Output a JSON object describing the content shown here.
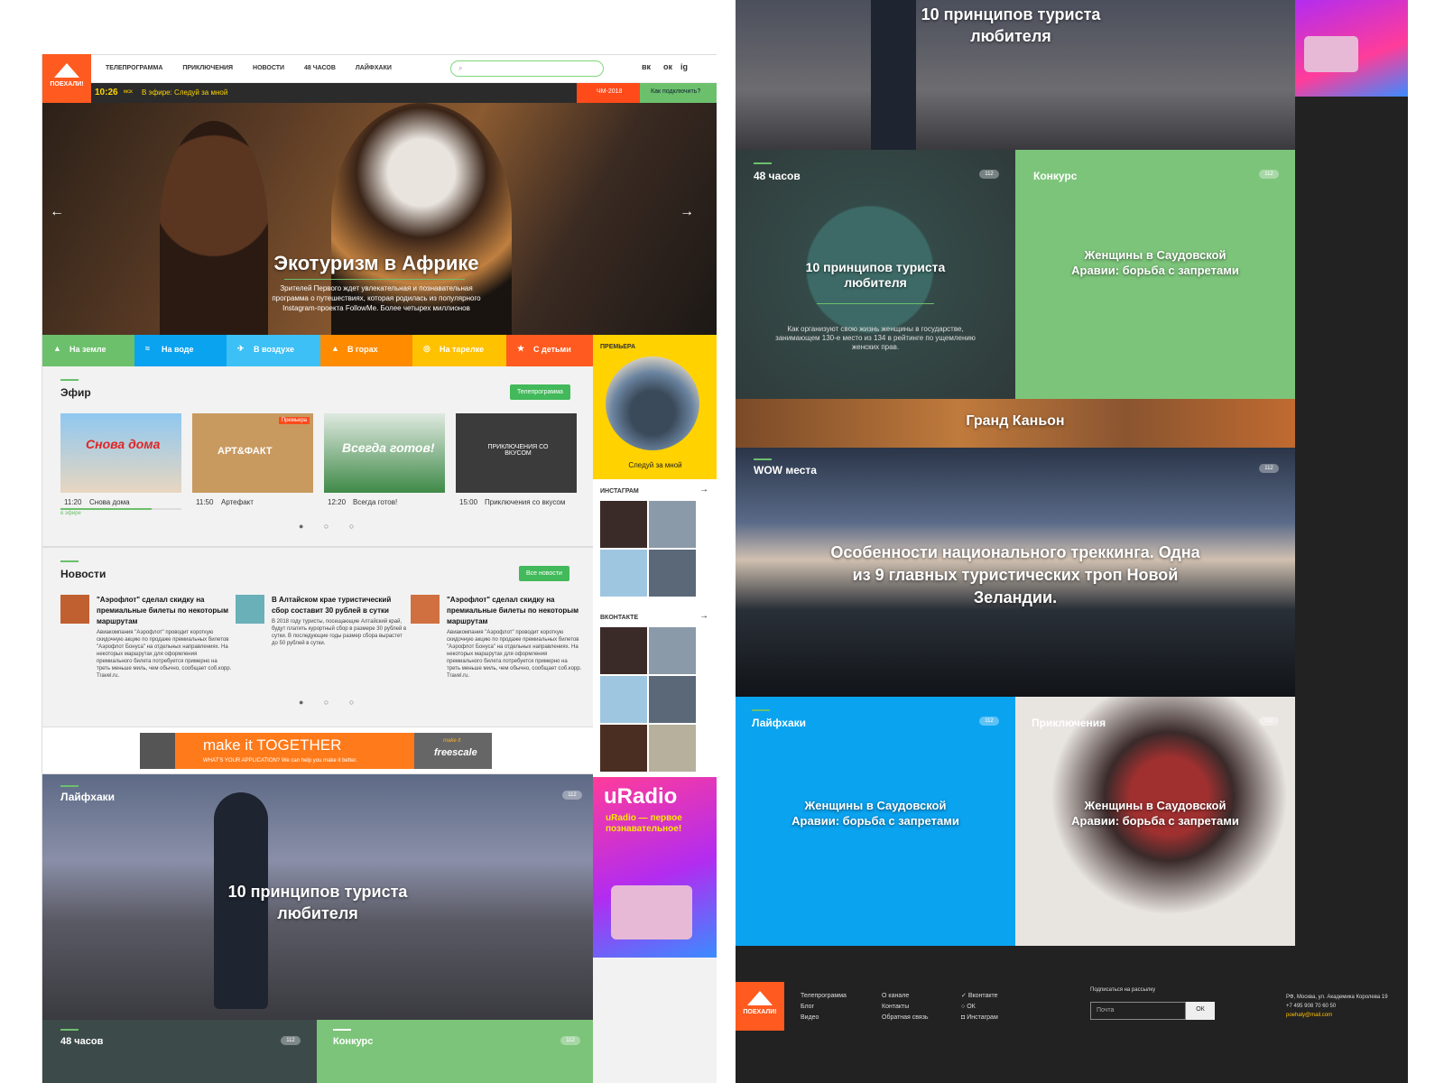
{
  "site": {
    "logo_text": "ПОЕХАЛИ!"
  },
  "nav": {
    "items": [
      "ТЕЛЕПРОГРАММА",
      "ПРИКЛЮЧЕНИЯ",
      "НОВОСТИ",
      "48 ЧАСОВ",
      "ЛАЙФХАКИ"
    ],
    "social": [
      "вк",
      "ок",
      "ig"
    ]
  },
  "ticker": {
    "time": "10:26",
    "tz": "мск",
    "on_air": "В эфире: Следуй за мной",
    "cup": "ЧМ-2018",
    "connect": "Как подключить?"
  },
  "hero": {
    "title": "Экотуризм в Африке",
    "text": "Зрителей Первого ждет увлекательная и познавательная программа о путешествиях, которая родилась из популярного Instagram-проекта FollowMe. Более четырех миллионов"
  },
  "categories": [
    "На земле",
    "На воде",
    "В воздухе",
    "В горах",
    "На тарелке",
    "С детьми"
  ],
  "premiere": {
    "label": "ПРЕМЬЕРА",
    "title": "Следуй за мной"
  },
  "efir": {
    "title": "Эфир",
    "button": "Телепрограмма",
    "items": [
      {
        "time": "11:20",
        "name": "Снова дома",
        "thumb": "Снова дома",
        "tag": ""
      },
      {
        "time": "11:50",
        "name": "Артефакт",
        "thumb": "АРТ&ФАКТ",
        "tag": "Премьера"
      },
      {
        "time": "12:20",
        "name": "Всегда готов!",
        "thumb": "Всегда готов!",
        "tag": ""
      },
      {
        "time": "15:00",
        "name": "Приключения со вкусом",
        "thumb": "ПРИКЛЮЧЕНИЯ СО ВКУСОМ",
        "tag": ""
      }
    ],
    "live": "в эфире"
  },
  "instagram": {
    "title": "ИНСТАГРАМ"
  },
  "vk": {
    "title": "ВКОНТАКТЕ"
  },
  "news": {
    "title": "Новости",
    "button": "Все новости",
    "items": [
      {
        "title": "\"Аэрофлот\" сделал скидку на премиальные билеты по некоторым маршрутам",
        "text": "Авиакомпания \"Аэрофлот\" проводит короткую скидочную акцию по продаже премиальных билетов \"Аэрофлот Бонуса\" на отдельных направлениях. На некоторых маршрутах для оформления премиального билета потребуется примерно на треть меньше миль, чем обычно, сообщает соб.корр. Travel.ru."
      },
      {
        "title": "В Алтайском крае туристический сбор составит 30 рублей в сутки",
        "text": "В 2018 году туристы, посещающие Алтайский край, будут платить курортный сбор в размере 30 рублей в сутки. В последующие годы размер сбора вырастет до 50 рублей в сутки."
      },
      {
        "title": "\"Аэрофлот\" сделал скидку на премиальные билеты по некоторым маршрутам",
        "text": "Авиакомпания \"Аэрофлот\" проводит короткую скидочную акцию по продаже премиальных билетов \"Аэрофлот Бонуса\" на отдельных направлениях. На некоторых маршрутах для оформления премиального билета потребуется примерно на треть меньше миль, чем обычно, сообщает соб.корр. Travel.ru."
      }
    ]
  },
  "ad": {
    "line1": "make it TOGETHER",
    "line2": "WHAT'S YOUR APPLICATION? We can help you make it better.",
    "brand": "freescale",
    "brand_top": "make it"
  },
  "uradio": {
    "title": "uRadio",
    "sub": "uRadio — первое познавательное!"
  },
  "lifehacks": {
    "label": "Лайфхаки",
    "title": "10 принципов туриста любителя",
    "views": "112"
  },
  "h48": {
    "label": "48 часов",
    "views": "112"
  },
  "contest": {
    "label": "Конкурс",
    "views": "112"
  },
  "right": {
    "top_title": "10 принципов туриста любителя",
    "h48": {
      "label": "48 часов",
      "title": "10 принципов туриста любителя",
      "text": "Как организуют свою жизнь женщины в государстве, занимающем 130-е место из 134 в рейтинге по ущемлению женских прав.",
      "views": "112"
    },
    "contest": {
      "label": "Конкурс",
      "title": "Женщины в Саудовской Аравии: борьба с запретами",
      "views": "112"
    },
    "canyon": "Гранд Каньон",
    "wow": {
      "label": "WOW места",
      "title": "Особенности национального треккинга. Одна из 9 главных туристических троп Новой Зеландии.",
      "views": "112"
    },
    "lifehacks": {
      "label": "Лайфхаки",
      "title": "Женщины в Саудовской Аравии: борьба с запретами",
      "views": "112"
    },
    "adventures": {
      "label": "Приключения",
      "title": "Женщины в Саудовской Аравии: борьба с запретами",
      "views": "112"
    }
  },
  "footer": {
    "col1": [
      "Телепрограмма",
      "Блог",
      "Видео"
    ],
    "col2": [
      "О канале",
      "Контакты",
      "Обратная связь"
    ],
    "col3": [
      "Вконтакте",
      "ОК",
      "Инстаграм"
    ],
    "subscribe_label": "Подписаться на рассылку",
    "email_placeholder": "Почта",
    "ok": "ОК",
    "address": "РФ, Москва, ул. Академика Королева 19",
    "phone": "+7 495 908 70 60 50",
    "email": "poehaly@mail.com"
  },
  "colors": {
    "green": "#6cc06c",
    "blue": "#0aa3f0",
    "sky": "#3cc0f5",
    "orange": "#ff8c00",
    "yellow": "#ffc200",
    "red": "#ff5a1f",
    "premiere": "#ffd200"
  }
}
